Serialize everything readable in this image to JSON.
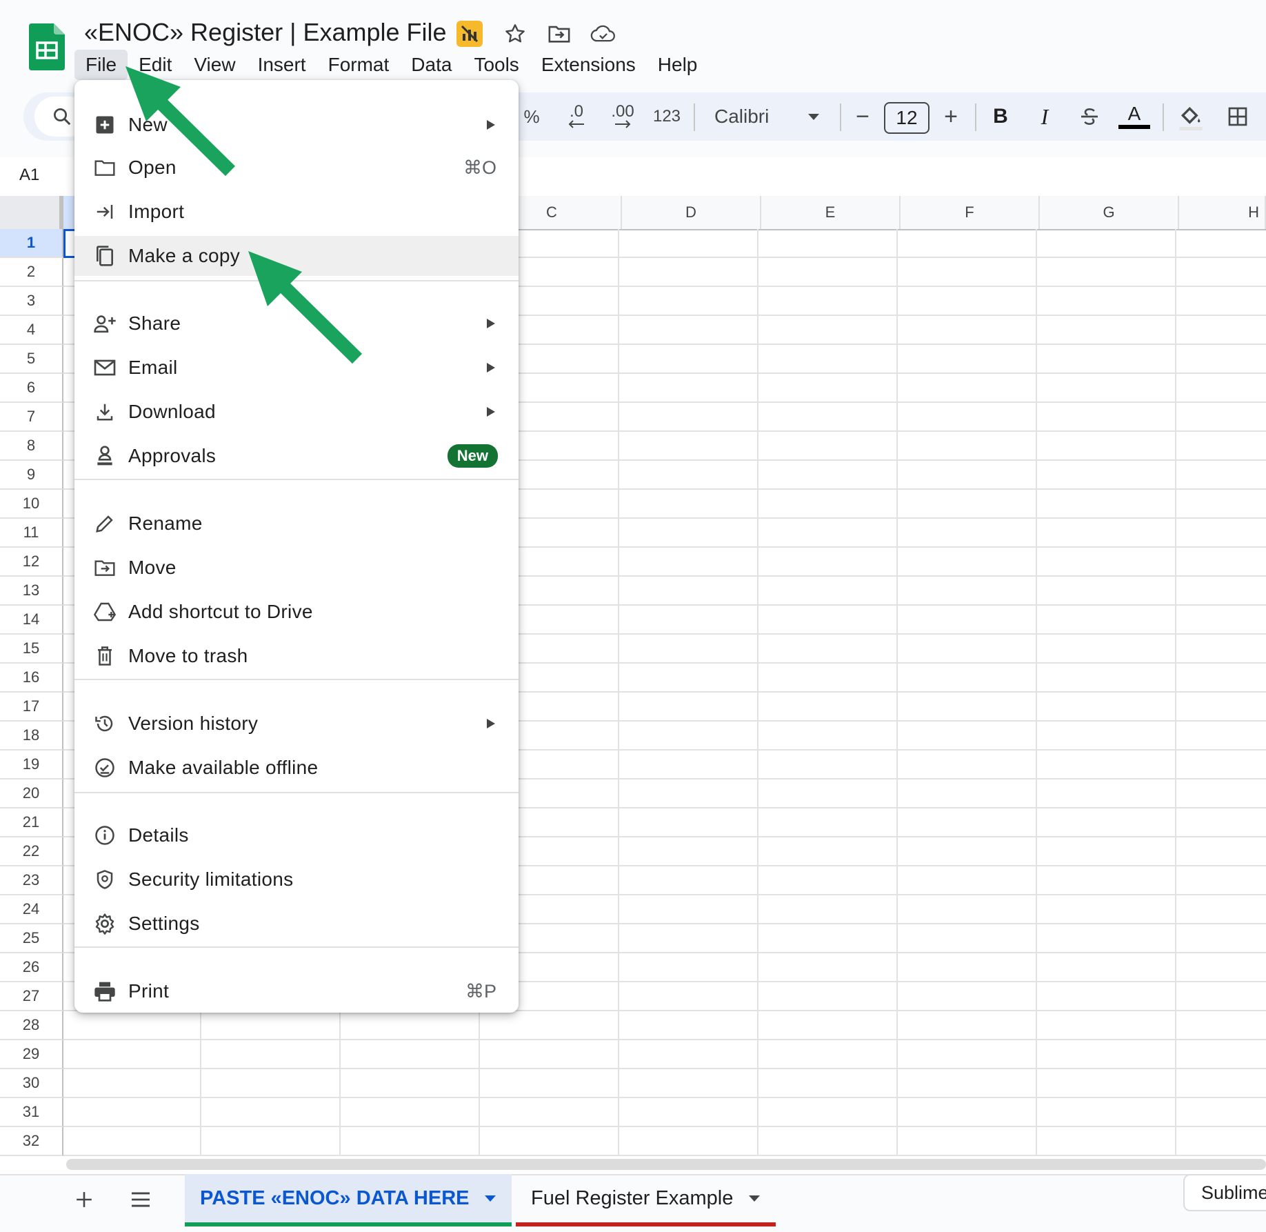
{
  "document": {
    "title": "«ENOC» Register | Example File"
  },
  "menubar": [
    "File",
    "Edit",
    "View",
    "Insert",
    "Format",
    "Data",
    "Tools",
    "Extensions",
    "Help"
  ],
  "toolbar": {
    "percent": "%",
    "decimal_decrease": ".0",
    "decimal_increase": ".00",
    "number_format": "123",
    "font_family": "Calibri",
    "font_size": "12",
    "minus": "−",
    "plus": "+",
    "bold": "B",
    "italic": "I",
    "text_color_letter": "A"
  },
  "name_box": "A1",
  "columns": [
    "C",
    "D",
    "E",
    "F",
    "G",
    "H"
  ],
  "rows": [
    "1",
    "2",
    "3",
    "4",
    "5",
    "6",
    "7",
    "8",
    "9",
    "10",
    "11",
    "12",
    "13",
    "14",
    "15",
    "16",
    "17",
    "18",
    "19",
    "20",
    "21",
    "22",
    "23",
    "24",
    "25",
    "26",
    "27",
    "28",
    "29",
    "30",
    "31",
    "32"
  ],
  "file_menu": {
    "items": [
      {
        "label": "New",
        "icon": "new-sheet-icon",
        "submenu": true
      },
      {
        "label": "Open",
        "icon": "folder-icon",
        "shortcut": "⌘O"
      },
      {
        "label": "Import",
        "icon": "import-icon"
      },
      {
        "label": "Make a copy",
        "icon": "copy-icon",
        "highlighted": true
      },
      {
        "label": "Share",
        "icon": "share-person-icon",
        "submenu": true
      },
      {
        "label": "Email",
        "icon": "email-icon",
        "submenu": true
      },
      {
        "label": "Download",
        "icon": "download-icon",
        "submenu": true
      },
      {
        "label": "Approvals",
        "icon": "approvals-icon",
        "badge": "New"
      },
      {
        "label": "Rename",
        "icon": "pencil-icon"
      },
      {
        "label": "Move",
        "icon": "move-folder-icon"
      },
      {
        "label": "Add shortcut to Drive",
        "icon": "drive-shortcut-icon"
      },
      {
        "label": "Move to trash",
        "icon": "trash-icon"
      },
      {
        "label": "Version history",
        "icon": "history-icon",
        "submenu": true
      },
      {
        "label": "Make available offline",
        "icon": "offline-icon"
      },
      {
        "label": "Details",
        "icon": "info-icon"
      },
      {
        "label": "Security limitations",
        "icon": "security-shield-icon"
      },
      {
        "label": "Settings",
        "icon": "gear-icon"
      },
      {
        "label": "Print",
        "icon": "printer-icon",
        "shortcut": "⌘P"
      }
    ]
  },
  "sheet_tabs": [
    {
      "label": "PASTE «ENOC» DATA HERE",
      "active": true
    },
    {
      "label": "Fuel Register Example",
      "active": false
    }
  ],
  "side_button": "Sublime",
  "colors": {
    "sheets_green": "#0f9d58",
    "annotation_arrow": "#1aa35c",
    "active_tab_text": "#0b57d0",
    "badge_green": "#137333"
  }
}
